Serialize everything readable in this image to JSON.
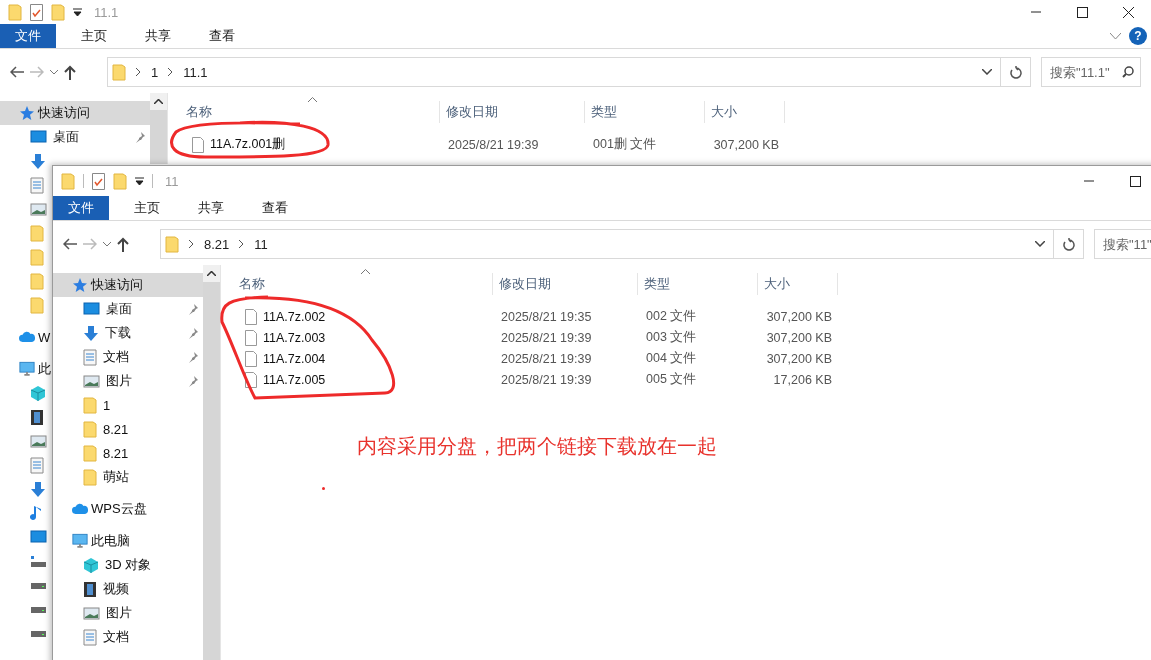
{
  "windows": [
    {
      "title": "11.1",
      "window_buttons": [
        {
          "kind": "minimize"
        },
        {
          "kind": "maximize"
        },
        {
          "kind": "close"
        }
      ],
      "ribbon_tabs": [
        {
          "label": "文件",
          "selected": true
        },
        {
          "label": "主页",
          "selected": false
        },
        {
          "label": "共享",
          "selected": false
        },
        {
          "label": "查看",
          "selected": false
        }
      ],
      "help_button": "?",
      "path": [
        "1",
        "11.1"
      ],
      "search": {
        "placeholder": "搜索\"11.1\""
      },
      "nav": [
        {
          "label": "快速访问",
          "kind": "star",
          "selected": true,
          "children": [
            {
              "label": "桌面",
              "kind": "desktop",
              "pinned": true
            },
            {
              "kind": "download"
            },
            {
              "kind": "document"
            },
            {
              "kind": "picture"
            },
            {
              "kind": "folder"
            },
            {
              "kind": "folder"
            },
            {
              "kind": "folder"
            },
            {
              "kind": "folder"
            }
          ]
        },
        {
          "label": "W",
          "kind": "cloud",
          "selected": false
        },
        {
          "label": "此",
          "kind": "pc",
          "selected": false,
          "children": [
            {
              "kind": "cube"
            },
            {
              "kind": "film"
            },
            {
              "kind": "picture"
            },
            {
              "kind": "document"
            },
            {
              "kind": "download"
            },
            {
              "kind": "music"
            },
            {
              "kind": "desktop"
            },
            {
              "kind": "netdrive"
            },
            {
              "kind": "drive"
            },
            {
              "kind": "drive"
            },
            {
              "kind": "drive"
            }
          ]
        }
      ],
      "columns": [
        "名称",
        "修改日期",
        "类型",
        "大小"
      ],
      "files": [
        {
          "name": "11A.7z.001删",
          "modified": "2025/8/21 19:39",
          "type": "001删 文件",
          "size": "307,200 KB"
        }
      ]
    },
    {
      "title": "11",
      "window_buttons": [
        {
          "kind": "minimize"
        },
        {
          "kind": "maximize"
        }
      ],
      "ribbon_tabs": [
        {
          "label": "文件",
          "selected": true
        },
        {
          "label": "主页",
          "selected": false
        },
        {
          "label": "共享",
          "selected": false
        },
        {
          "label": "查看",
          "selected": false
        }
      ],
      "path": [
        "8.21",
        "11"
      ],
      "search": {
        "placeholder": "搜索\"11\""
      },
      "nav": [
        {
          "label": "快速访问",
          "kind": "star",
          "selected": true,
          "children": [
            {
              "label": "桌面",
              "kind": "desktop",
              "pinned": true
            },
            {
              "label": "下载",
              "kind": "download",
              "pinned": true
            },
            {
              "label": "文档",
              "kind": "document",
              "pinned": true
            },
            {
              "label": "图片",
              "kind": "picture",
              "pinned": true
            },
            {
              "label": "1",
              "kind": "folder",
              "pinned": false
            },
            {
              "label": "8.21",
              "kind": "folder",
              "pinned": false
            },
            {
              "label": "8.21",
              "kind": "folder",
              "pinned": false
            },
            {
              "label": "萌站",
              "kind": "folder",
              "pinned": false
            }
          ]
        },
        {
          "label": "WPS云盘",
          "kind": "cloud",
          "selected": false
        },
        {
          "label": "此电脑",
          "kind": "pc",
          "selected": false,
          "children": [
            {
              "label": "3D 对象",
              "kind": "cube"
            },
            {
              "label": "视频",
              "kind": "film"
            },
            {
              "label": "图片",
              "kind": "picture"
            },
            {
              "label": "文档",
              "kind": "document"
            }
          ]
        }
      ],
      "columns": [
        "名称",
        "修改日期",
        "类型",
        "大小"
      ],
      "files": [
        {
          "name": "11A.7z.002",
          "modified": "2025/8/21 19:35",
          "type": "002 文件",
          "size": "307,200 KB"
        },
        {
          "name": "11A.7z.003",
          "modified": "2025/8/21 19:39",
          "type": "003 文件",
          "size": "307,200 KB"
        },
        {
          "name": "11A.7z.004",
          "modified": "2025/8/21 19:39",
          "type": "004 文件",
          "size": "307,200 KB"
        },
        {
          "name": "11A.7z.005",
          "modified": "2025/8/21 19:39",
          "type": "005 文件",
          "size": "17,206 KB"
        }
      ]
    }
  ],
  "annotation": {
    "text": "内容采用分盘，把两个链接下载放在一起"
  }
}
